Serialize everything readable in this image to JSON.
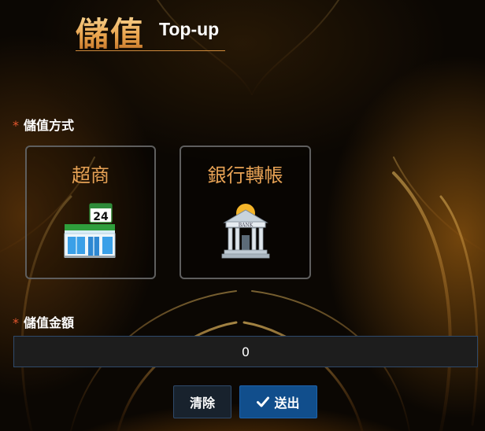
{
  "header": {
    "title_zh": "儲值",
    "title_en": "Top-up"
  },
  "method_section": {
    "required_mark": "*",
    "label": "儲值方式",
    "options": [
      {
        "label": "超商",
        "icon": "convenience-store-icon"
      },
      {
        "label": "銀行轉帳",
        "icon": "bank-icon"
      }
    ]
  },
  "amount_section": {
    "required_mark": "*",
    "label": "儲值金額",
    "value": "0"
  },
  "buttons": {
    "clear_label": "清除",
    "submit_label": "送出"
  },
  "store_badge": "24",
  "bank_sign": "BANK",
  "colors": {
    "accent": "#e7a255",
    "required": "#e4572e",
    "submit": "#114e8c",
    "input_bg": "#1d1d1d"
  }
}
